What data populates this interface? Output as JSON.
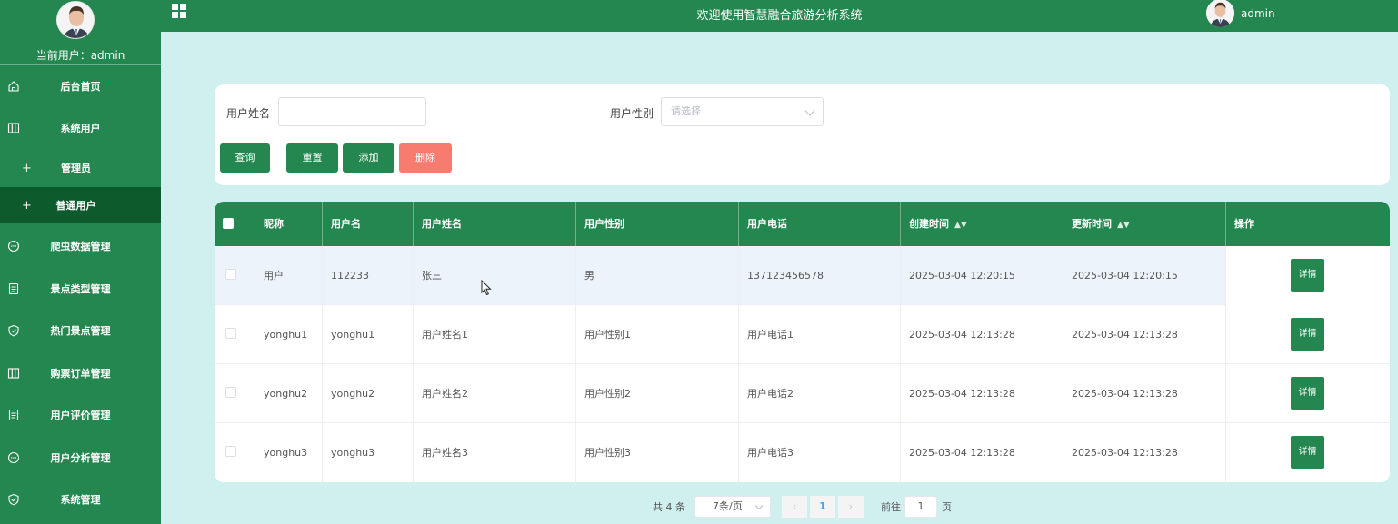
{
  "app": {
    "title": "欢迎使用智慧融合旅游分析系统",
    "current_user_label": "当前用户：",
    "current_user": "admin",
    "top_user": "admin"
  },
  "sidebar": {
    "items": [
      {
        "label": "后台首页",
        "icon": "home-icon"
      },
      {
        "label": "系统用户",
        "icon": "columns-icon"
      },
      {
        "label": "管理员",
        "icon": "plus-icon",
        "sub": true
      },
      {
        "label": "普通用户",
        "icon": "plus-icon",
        "sub": true,
        "active": true
      },
      {
        "label": "爬虫数据管理",
        "icon": "chat-icon"
      },
      {
        "label": "景点类型管理",
        "icon": "document-icon"
      },
      {
        "label": "热门景点管理",
        "icon": "shield-icon"
      },
      {
        "label": "购票订单管理",
        "icon": "columns-icon"
      },
      {
        "label": "用户评价管理",
        "icon": "document-icon"
      },
      {
        "label": "用户分析管理",
        "icon": "chat-icon"
      },
      {
        "label": "系统管理",
        "icon": "shield-icon"
      }
    ]
  },
  "search": {
    "name_label": "用户姓名",
    "name_value": "",
    "gender_label": "用户性别",
    "gender_placeholder": "请选择",
    "buttons": {
      "query": "查询",
      "reset": "重置",
      "add": "添加",
      "delete": "删除"
    }
  },
  "table": {
    "columns": [
      "昵称",
      "用户名",
      "用户姓名",
      "用户性别",
      "用户电话",
      "创建时间",
      "更新时间",
      "操作"
    ],
    "rows": [
      {
        "nickname": "用户",
        "username": "112233",
        "name": "张三",
        "gender": "男",
        "phone": "137123456578",
        "created": "2025-03-04 12:20:15",
        "updated": "2025-03-04 12:20:15",
        "action": "详情"
      },
      {
        "nickname": "yonghu1",
        "username": "yonghu1",
        "name": "用户姓名1",
        "gender": "用户性别1",
        "phone": "用户电话1",
        "created": "2025-03-04 12:13:28",
        "updated": "2025-03-04 12:13:28",
        "action": "详情"
      },
      {
        "nickname": "yonghu2",
        "username": "yonghu2",
        "name": "用户姓名2",
        "gender": "用户性别2",
        "phone": "用户电话2",
        "created": "2025-03-04 12:13:28",
        "updated": "2025-03-04 12:13:28",
        "action": "详情"
      },
      {
        "nickname": "yonghu3",
        "username": "yonghu3",
        "name": "用户姓名3",
        "gender": "用户性别3",
        "phone": "用户电话3",
        "created": "2025-03-04 12:13:28",
        "updated": "2025-03-04 12:13:28",
        "action": "详情"
      }
    ]
  },
  "pagination": {
    "total": "共 4 条",
    "page_size": "7条/页",
    "current_page": "1",
    "goto_label": "前往",
    "goto_value": "1",
    "page_suffix": "页"
  },
  "colors": {
    "primary": "#23874f",
    "active": "#0d5a2d",
    "danger": "#f77b6f",
    "page_bg": "#cff0ef"
  }
}
